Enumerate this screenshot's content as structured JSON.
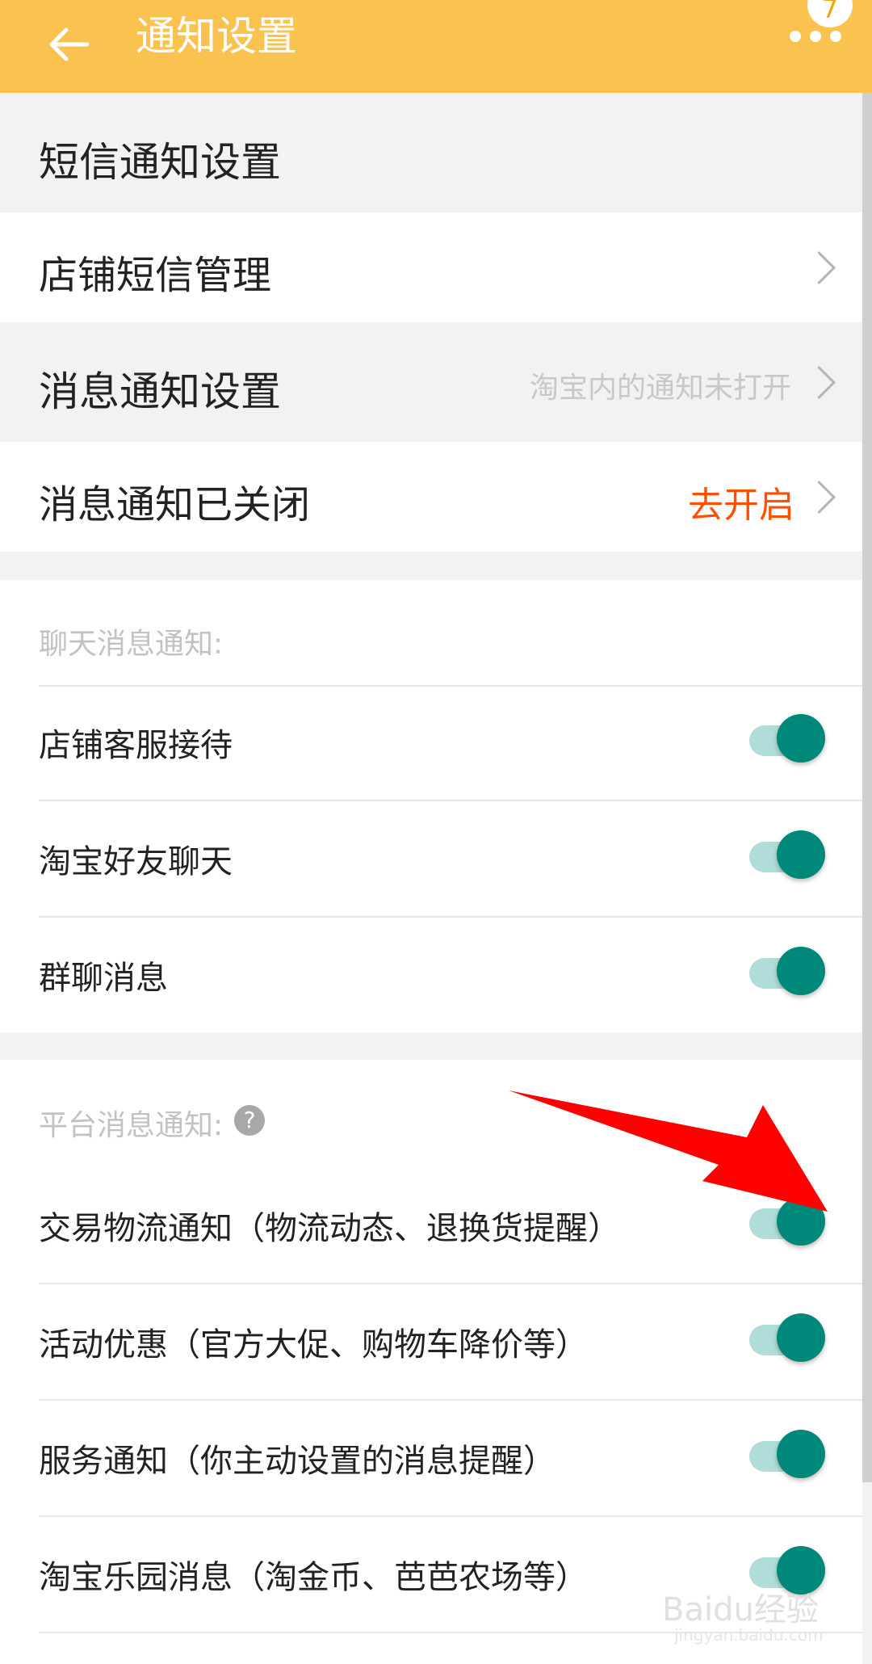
{
  "header": {
    "title": "通知设置",
    "badge": "7"
  },
  "sms_section": {
    "title": "短信通知设置",
    "item": {
      "label": "店铺短信管理"
    }
  },
  "msg_section": {
    "title": "消息通知设置",
    "hint": "淘宝内的通知未打开"
  },
  "msg_closed": {
    "label": "消息通知已关闭",
    "action": "去开启"
  },
  "chat_group": {
    "title": "聊天消息通知:",
    "items": [
      {
        "label": "店铺客服接待",
        "on": true
      },
      {
        "label": "淘宝好友聊天",
        "on": true
      },
      {
        "label": "群聊消息",
        "on": true
      }
    ]
  },
  "platform_group": {
    "title": "平台消息通知:",
    "help_icon": "?",
    "items": [
      {
        "label": "交易物流通知（物流动态、退换货提醒）",
        "on": true
      },
      {
        "label": "活动优惠（官方大促、购物车降价等）",
        "on": true
      },
      {
        "label": "服务通知（你主动设置的消息提醒）",
        "on": true
      },
      {
        "label": "淘宝乐园消息（淘金币、芭芭农场等）",
        "on": true
      }
    ]
  },
  "watermark": {
    "text": "Baidu经验",
    "url_text": "jingyan.baidu.com"
  },
  "colors": {
    "header": "#fac350",
    "accent": "#00897b",
    "track": "#b0dcd9",
    "action": "#ff5000",
    "arrow": "#ff0000"
  }
}
